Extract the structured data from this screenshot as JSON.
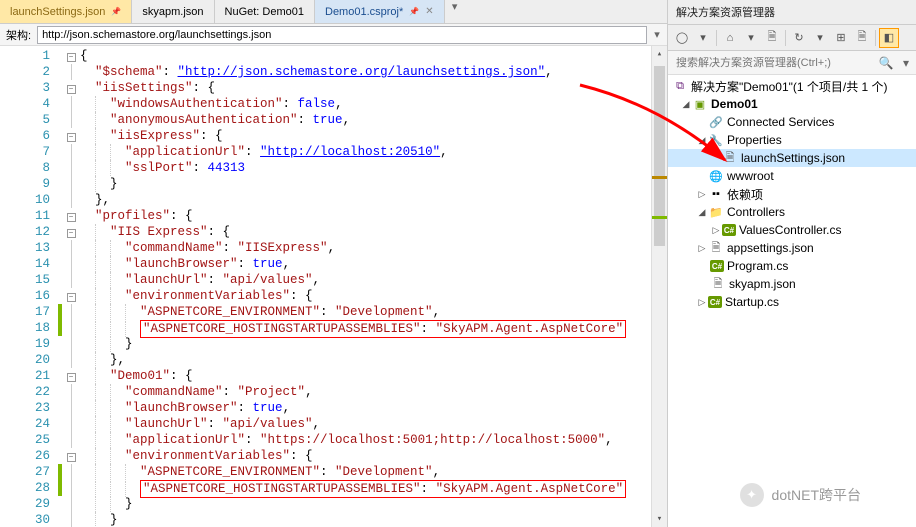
{
  "tabs": [
    {
      "label": "launchSettings.json",
      "active": true,
      "pinned": true
    },
    {
      "label": "skyapm.json",
      "active": false
    },
    {
      "label": "NuGet: Demo01",
      "active": false
    },
    {
      "label": "Demo01.csproj*",
      "active": false,
      "pinned": true
    }
  ],
  "schema_label": "架构:",
  "schema_url": "http://json.schemastore.org/launchsettings.json",
  "side_title": "解决方案资源管理器",
  "search_placeholder": "搜索解决方案资源管理器(Ctrl+;)",
  "solution_label": "解决方案\"Demo01\"(1 个项目/共 1 个)",
  "tree": {
    "project": "Demo01",
    "connected": "Connected Services",
    "properties": "Properties",
    "launch": "launchSettings.json",
    "wwwroot": "wwwroot",
    "deps": "依赖项",
    "controllers": "Controllers",
    "valuesctrl": "ValuesController.cs",
    "appsettings": "appsettings.json",
    "program": "Program.cs",
    "skyapm": "skyapm.json",
    "startup": "Startup.cs"
  },
  "code": {
    "schema_key": "\"$schema\"",
    "schema_val": "\"http://json.schemastore.org/launchsettings.json\"",
    "iisSettings": "\"iisSettings\"",
    "winAuth": "\"windowsAuthentication\"",
    "anonAuth": "\"anonymousAuthentication\"",
    "iisExpress": "\"iisExpress\"",
    "appUrl": "\"applicationUrl\"",
    "appUrlVal": "\"http://localhost:20510\"",
    "sslPort": "\"sslPort\"",
    "sslPortVal": "44313",
    "profiles": "\"profiles\"",
    "iisExpProf": "\"IIS Express\"",
    "commandName": "\"commandName\"",
    "iisExpVal": "\"IISExpress\"",
    "launchBrowser": "\"launchBrowser\"",
    "launchUrl": "\"launchUrl\"",
    "launchUrlVal": "\"api/values\"",
    "envVars": "\"environmentVariables\"",
    "aspEnv": "\"ASPNETCORE_ENVIRONMENT\"",
    "devVal": "\"Development\"",
    "aspHost": "\"ASPNETCORE_HOSTINGSTARTUPASSEMBLIES\"",
    "skyVal": "\"SkyAPM.Agent.AspNetCore\"",
    "demo01": "\"Demo01\"",
    "projectVal": "\"Project\"",
    "appUrlVal2": "\"https://localhost:5001;http://localhost:5000\"",
    "true": "true",
    "false": "false"
  },
  "watermark": "dotNET跨平台"
}
